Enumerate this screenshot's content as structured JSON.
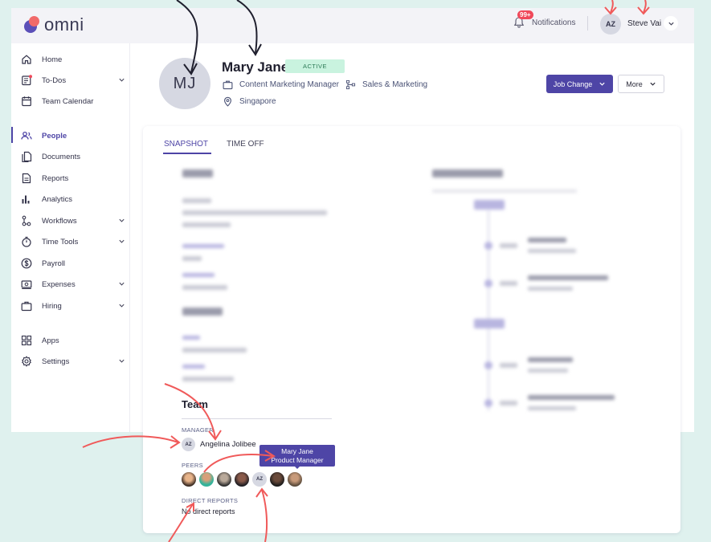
{
  "brand": {
    "name": "omni",
    "primary": "#4e45a6",
    "logo_red": "#f16a6a"
  },
  "topbar": {
    "notifications_label": "Notifications",
    "notifications_badge": "99+",
    "user_initials": "AZ",
    "user_name": "Steve Vai"
  },
  "sidebar": {
    "items": [
      {
        "label": "Home",
        "icon": "home-icon",
        "has_chevron": false
      },
      {
        "label": "To-Dos",
        "icon": "todo-icon",
        "has_chevron": true
      },
      {
        "label": "Team Calendar",
        "icon": "calendar-icon",
        "has_chevron": false
      },
      {
        "label": "People",
        "icon": "people-icon",
        "has_chevron": false,
        "active": true
      },
      {
        "label": "Documents",
        "icon": "documents-icon",
        "has_chevron": false
      },
      {
        "label": "Reports",
        "icon": "reports-icon",
        "has_chevron": false
      },
      {
        "label": "Analytics",
        "icon": "analytics-icon",
        "has_chevron": false
      },
      {
        "label": "Workflows",
        "icon": "workflows-icon",
        "has_chevron": true
      },
      {
        "label": "Time Tools",
        "icon": "timer-icon",
        "has_chevron": true
      },
      {
        "label": "Payroll",
        "icon": "dollar-icon",
        "has_chevron": false
      },
      {
        "label": "Expenses",
        "icon": "expenses-icon",
        "has_chevron": true
      },
      {
        "label": "Hiring",
        "icon": "briefcase-icon",
        "has_chevron": true
      },
      {
        "label": "Apps",
        "icon": "apps-icon",
        "has_chevron": false
      },
      {
        "label": "Settings",
        "icon": "gear-icon",
        "has_chevron": true
      }
    ]
  },
  "profile": {
    "initials": "MJ",
    "name": "Mary Jane",
    "status": "ACTIVE",
    "job_title": "Content Marketing Manager",
    "department": "Sales & Marketing",
    "location": "Singapore",
    "job_change_label": "Job Change",
    "more_label": "More"
  },
  "tabs": [
    {
      "label": "SNAPSHOT",
      "active": true
    },
    {
      "label": "TIME OFF",
      "active": false
    }
  ],
  "team": {
    "title": "Team",
    "manager_label": "MANAGER",
    "manager_initials": "AZ",
    "manager_name": "Angelina Jolibee",
    "peers_label": "PEERS",
    "peer_initials": "AZ",
    "direct_reports_label": "DIRECT REPORTS",
    "direct_reports_value": "No direct reports"
  },
  "tooltip": {
    "name": "Mary Jane",
    "title": "Product Manager"
  },
  "annotation_colors": {
    "dark_arrow": "#1f1f2e",
    "red_arrow": "#f05a5a"
  }
}
